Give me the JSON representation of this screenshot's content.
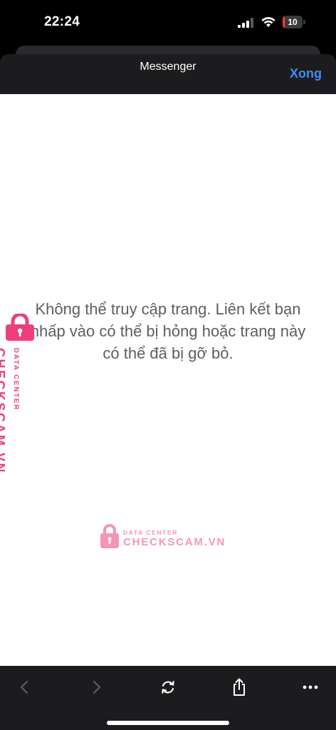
{
  "status_bar": {
    "time": "22:24",
    "battery_level": "10",
    "battery_color": "#ff3b30"
  },
  "header": {
    "title": "Messenger",
    "done_label": "Xong",
    "accent_color": "#3a8ef6"
  },
  "content": {
    "message": "Không thể truy cập trang. Liên kết bạn nhấp vào có thể bị hỏng hoặc trang này có thể đã bị gỡ bỏ."
  },
  "watermark": {
    "brand": "CHECKSCAM.VN",
    "subtitle": "DATA CENTER",
    "color": "#ee3f7a"
  },
  "toolbar": {
    "icons": [
      "chevron-left-icon",
      "chevron-right-icon",
      "refresh-icon",
      "share-icon",
      "more-icon"
    ]
  }
}
